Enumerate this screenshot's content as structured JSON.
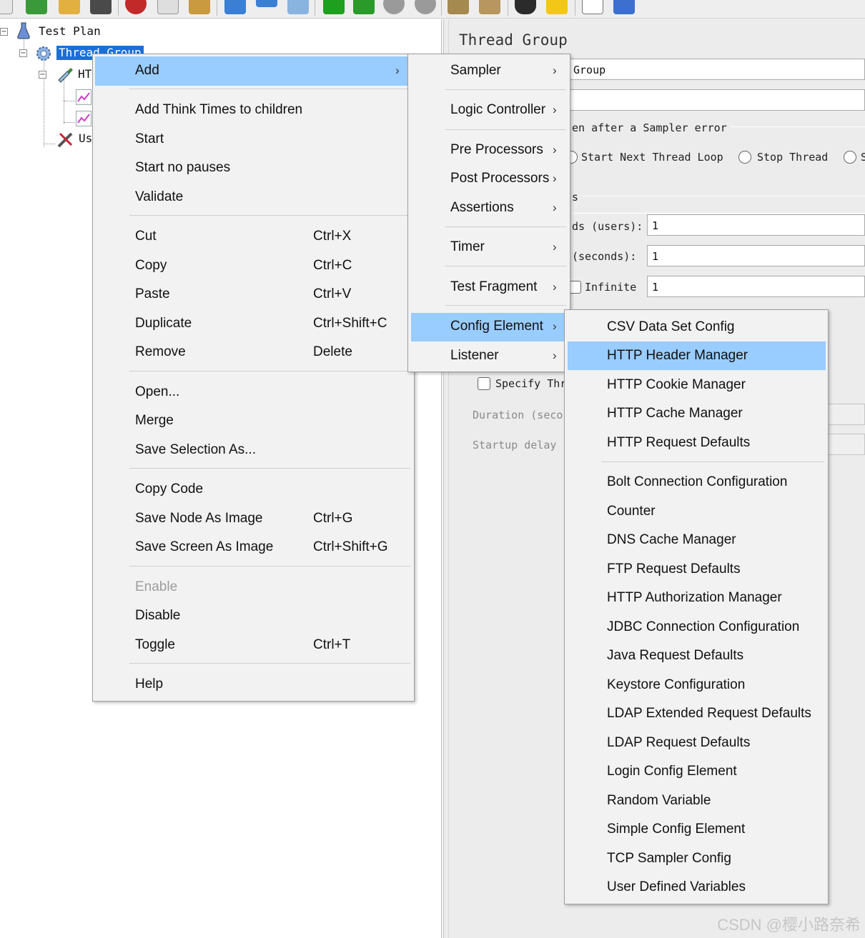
{
  "toolbar": {
    "icons": [
      "new-icon",
      "templates-icon",
      "open-icon",
      "save-icon",
      "cut-icon",
      "copy-icon",
      "paste-icon",
      "expand-icon",
      "collapse-icon",
      "toggle-icon",
      "start-icon",
      "start-no-pauses-icon",
      "stop-icon",
      "shutdown-icon",
      "clear-icon",
      "clear-all-icon",
      "search-icon",
      "reset-search-icon",
      "function-helper-icon",
      "help-icon"
    ]
  },
  "tree": {
    "test_plan": "Test Plan",
    "thread_group": "Thread Group",
    "http_request_partial": "HT",
    "user_partial": "Us"
  },
  "right_panel": {
    "title": "Thread Group",
    "name_value": "Group",
    "sampler_error_label": "en after a Sampler error",
    "radio_start_next": "Start Next Thread Loop",
    "radio_stop_thread": "Stop Thread",
    "radio_partial": "S",
    "thread_props_partial": "s",
    "threads_label": "ds (users):",
    "threads_value": "1",
    "rampup_label": "(seconds):",
    "rampup_value": "1",
    "infinite_label": "Infinite",
    "loop_value": "1",
    "specify_label": "Specify Thr",
    "duration_label": "Duration (seco",
    "startup_label": "Startup delay"
  },
  "context_menu": {
    "add": "Add",
    "add_think_times": "Add Think Times to children",
    "start": "Start",
    "start_no_pauses": "Start no pauses",
    "validate": "Validate",
    "cut": "Cut",
    "cut_sc": "Ctrl+X",
    "copy": "Copy",
    "copy_sc": "Ctrl+C",
    "paste": "Paste",
    "paste_sc": "Ctrl+V",
    "duplicate": "Duplicate",
    "duplicate_sc": "Ctrl+Shift+C",
    "remove": "Remove",
    "remove_sc": "Delete",
    "open": "Open...",
    "merge": "Merge",
    "save_selection": "Save Selection As...",
    "copy_code": "Copy Code",
    "save_node_image": "Save Node As Image",
    "save_node_image_sc": "Ctrl+G",
    "save_screen_image": "Save Screen As Image",
    "save_screen_image_sc": "Ctrl+Shift+G",
    "enable": "Enable",
    "disable": "Disable",
    "toggle": "Toggle",
    "toggle_sc": "Ctrl+T",
    "help": "Help"
  },
  "add_submenu": {
    "sampler": "Sampler",
    "logic_controller": "Logic Controller",
    "pre_processors": "Pre Processors",
    "post_processors": "Post Processors",
    "assertions": "Assertions",
    "timer": "Timer",
    "test_fragment": "Test Fragment",
    "config_element": "Config Element",
    "listener": "Listener"
  },
  "config_submenu": {
    "items": [
      "CSV Data Set Config",
      "HTTP Header Manager",
      "HTTP Cookie Manager",
      "HTTP Cache Manager",
      "HTTP Request Defaults",
      "Bolt Connection Configuration",
      "Counter",
      "DNS Cache Manager",
      "FTP Request Defaults",
      "HTTP Authorization Manager",
      "JDBC Connection Configuration",
      "Java Request Defaults",
      "Keystore Configuration",
      "LDAP Extended Request Defaults",
      "LDAP Request Defaults",
      "Login Config Element",
      "Random Variable",
      "Simple Config Element",
      "TCP Sampler Config",
      "User Defined Variables"
    ]
  },
  "watermark": "CSDN @樱小路奈希",
  "colors": {
    "menu_highlight": "#99ccff",
    "tree_selection": "#1a6fd8",
    "menu_background": "#f2f2f2"
  }
}
